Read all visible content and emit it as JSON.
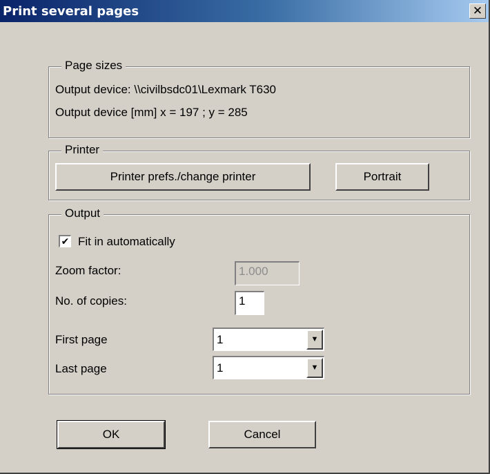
{
  "window": {
    "title": "Print several pages",
    "close_label": "✕"
  },
  "page_sizes": {
    "legend": "Page sizes",
    "device_line": "Output device: \\\\civilbsdc01\\Lexmark T630",
    "size_line": "Output device [mm]  x = 197 ; y = 285"
  },
  "printer": {
    "legend": "Printer",
    "prefs_label": "Printer prefs./change printer",
    "orientation_label": "Portrait"
  },
  "output": {
    "legend": "Output",
    "fit_label": "Fit in automatically",
    "fit_checked": true,
    "fit_check_mark": "✔",
    "zoom_label": "Zoom factor:",
    "zoom_value": "1.000",
    "copies_label": "No. of copies:",
    "copies_value": "1",
    "first_page_label": "First page",
    "first_page_value": "1",
    "last_page_label": "Last page",
    "last_page_value": "1",
    "dropdown_arrow": "▼"
  },
  "buttons": {
    "ok": "OK",
    "cancel": "Cancel"
  }
}
